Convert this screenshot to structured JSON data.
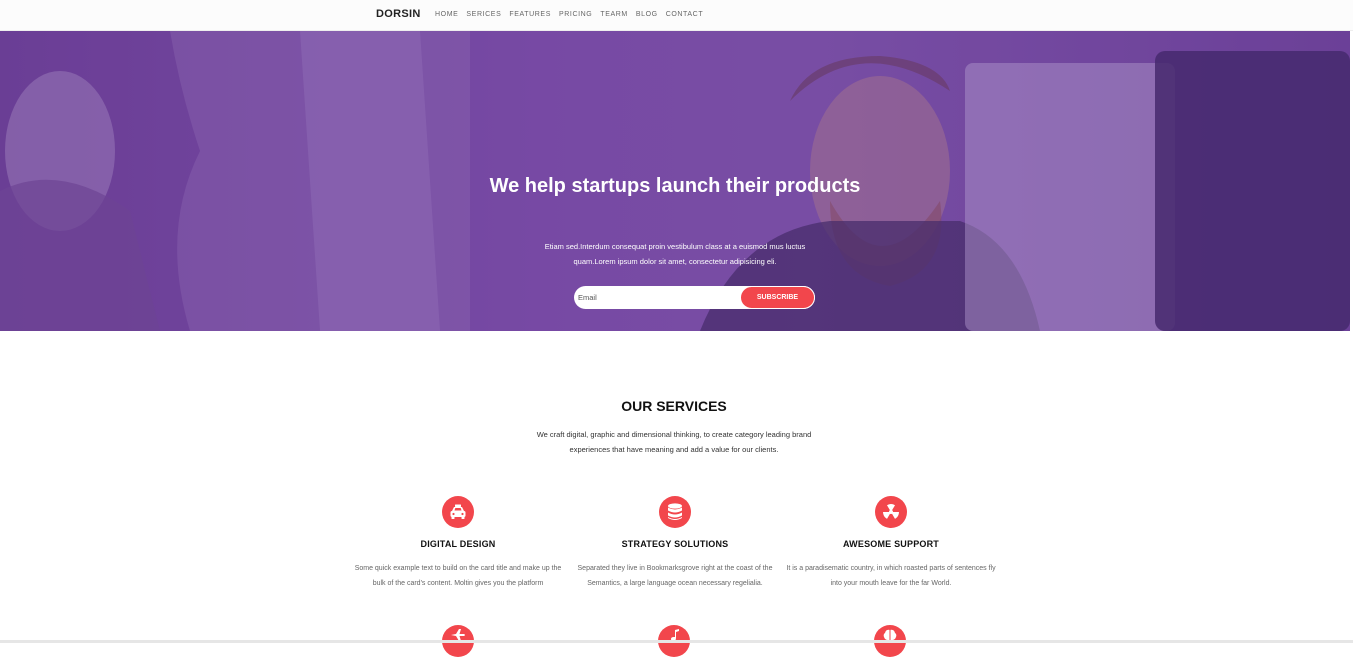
{
  "navbar": {
    "brand": "DORSIN",
    "links": [
      "HOME",
      "SERICES",
      "FEATURES",
      "PRICING",
      "TEARM",
      "BLOG",
      "CONTACT"
    ]
  },
  "hero": {
    "title": "We help startups launch their products",
    "text": "Etiam sed.Interdum consequat proin vestibulum class at a euismod mus luctus quam.Lorem ipsum dolor sit amet, consectetur adipisicing eli.",
    "email_placeholder": "Email",
    "subscribe_label": "SUBSCRIBE"
  },
  "services": {
    "title": "OUR SERVICES",
    "text": "We craft digital, graphic and dimensional thinking, to create category leading brand experiences that have meaning and add a value for our clients.",
    "items": [
      {
        "icon": "taxi-icon",
        "title": "DIGITAL DESIGN",
        "text": "Some quick example text to build on the card title and make up the bulk of the card's content. Moltin gives you the platform"
      },
      {
        "icon": "database-icon",
        "title": "STRATEGY SOLUTIONS",
        "text": "Separated they live in Bookmarksgrove right at the coast of the Semantics, a large language ocean necessary regelialia."
      },
      {
        "icon": "radiation-icon",
        "title": "AWESOME SUPPORT",
        "text": "It is a paradisematic country, in which roasted parts of sentences fly into your mouth leave for the far World."
      }
    ],
    "next_row_icons": [
      "plane-icon",
      "music-icon",
      "brain-icon"
    ]
  },
  "colors": {
    "accent": "#f2464c",
    "hero_overlay": "#7b53a6"
  }
}
